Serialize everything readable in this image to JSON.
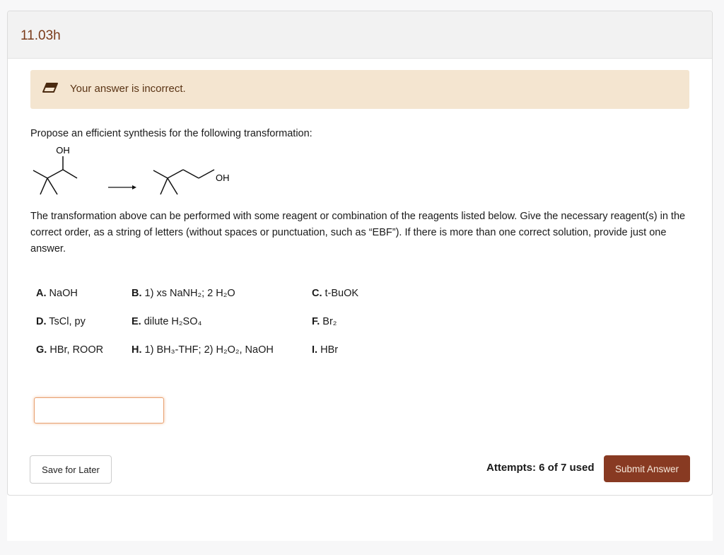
{
  "header": {
    "title": "11.03h"
  },
  "alert": {
    "icon": "eraser-icon",
    "message": "Your answer is incorrect.",
    "color": "#f4e5d0"
  },
  "question": {
    "prompt": "Propose an efficient synthesis for the following transformation:",
    "reactant_label": "OH",
    "product_label": "OH",
    "instructions": "The transformation above can be performed with some reagent or combination of the reagents listed below. Give the necessary reagent(s) in the correct order, as a string of letters (without spaces or punctuation, such as “EBF”).  If there is more than one correct solution, provide just one answer."
  },
  "reagents": [
    {
      "letter": "A.",
      "text": " NaOH"
    },
    {
      "letter": "B.",
      "text": " 1) xs NaNH₂; 2 H₂O"
    },
    {
      "letter": "C.",
      "text": " t-BuOK"
    },
    {
      "letter": "D.",
      "text": " TsCl, py"
    },
    {
      "letter": "E.",
      "text": " dilute H₂SO₄"
    },
    {
      "letter": "F.",
      "text": " Br₂"
    },
    {
      "letter": "G.",
      "text": " HBr, ROOR"
    },
    {
      "letter": "H.",
      "text": " 1) BH₃-THF; 2) H₂O₂, NaOH"
    },
    {
      "letter": "I.",
      "text": " HBr"
    }
  ],
  "answer": {
    "value": "",
    "placeholder": ""
  },
  "footer": {
    "save_label": "Save for Later",
    "attempts": "Attempts: 6 of 7 used",
    "submit_label": "Submit Answer",
    "submit_color": "#883a22"
  }
}
